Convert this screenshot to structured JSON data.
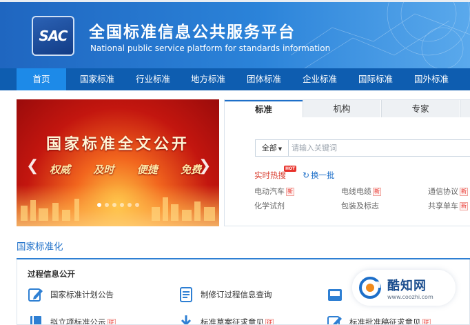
{
  "header": {
    "logo_text": "SAC",
    "title": "全国标准信息公共服务平台",
    "subtitle": "National public service platform  for standards information"
  },
  "nav": {
    "items": [
      "首页",
      "国家标准",
      "行业标准",
      "地方标准",
      "团体标准",
      "企业标准",
      "国际标准",
      "国外标准"
    ],
    "active_index": 0
  },
  "banner": {
    "title": "国家标准全文公开",
    "tags": [
      "权威",
      "及时",
      "便捷",
      "免费"
    ],
    "slide_count": 6,
    "active_slide": 0
  },
  "search": {
    "tabs": [
      "标准",
      "机构",
      "专家"
    ],
    "active_tab": 0,
    "scope": "全部",
    "placeholder": "请输入关键词",
    "hot_label": "实时热搜",
    "hot_badge": "HOT",
    "refresh_label": "换一批",
    "keywords": [
      {
        "text": "电动汽车",
        "new": "新"
      },
      {
        "text": "电线电缆",
        "new": "新"
      },
      {
        "text": "通信协议",
        "new": "新"
      },
      {
        "text": "化学试剂",
        "new": ""
      },
      {
        "text": "包装及标志",
        "new": ""
      },
      {
        "text": "共享单车",
        "new": "新"
      }
    ]
  },
  "section": {
    "title": "国家标准化"
  },
  "process": {
    "title": "过程信息公开",
    "items": [
      {
        "label": "国家标准计划公告",
        "icon": "edit-icon"
      },
      {
        "label": "制修订过程信息查询",
        "icon": "document-list-icon"
      },
      {
        "label": "",
        "icon": "inbox-icon"
      },
      {
        "label": "拟立项标准公示",
        "icon": "book-icon"
      },
      {
        "label": "标准草案征求意见",
        "icon": "download-icon"
      },
      {
        "label": "标准批准稿征求意见",
        "icon": "edit-icon"
      }
    ],
    "status_tag": "征"
  },
  "watermark": {
    "brand": "酷知网",
    "url": "www.coozhi.com"
  },
  "colors": {
    "header_blue": "#1f66c0",
    "nav_blue": "#0e5db0",
    "nav_active": "#1d8ae8",
    "accent_red": "#d83a2b",
    "link_blue": "#1d6fc9"
  }
}
